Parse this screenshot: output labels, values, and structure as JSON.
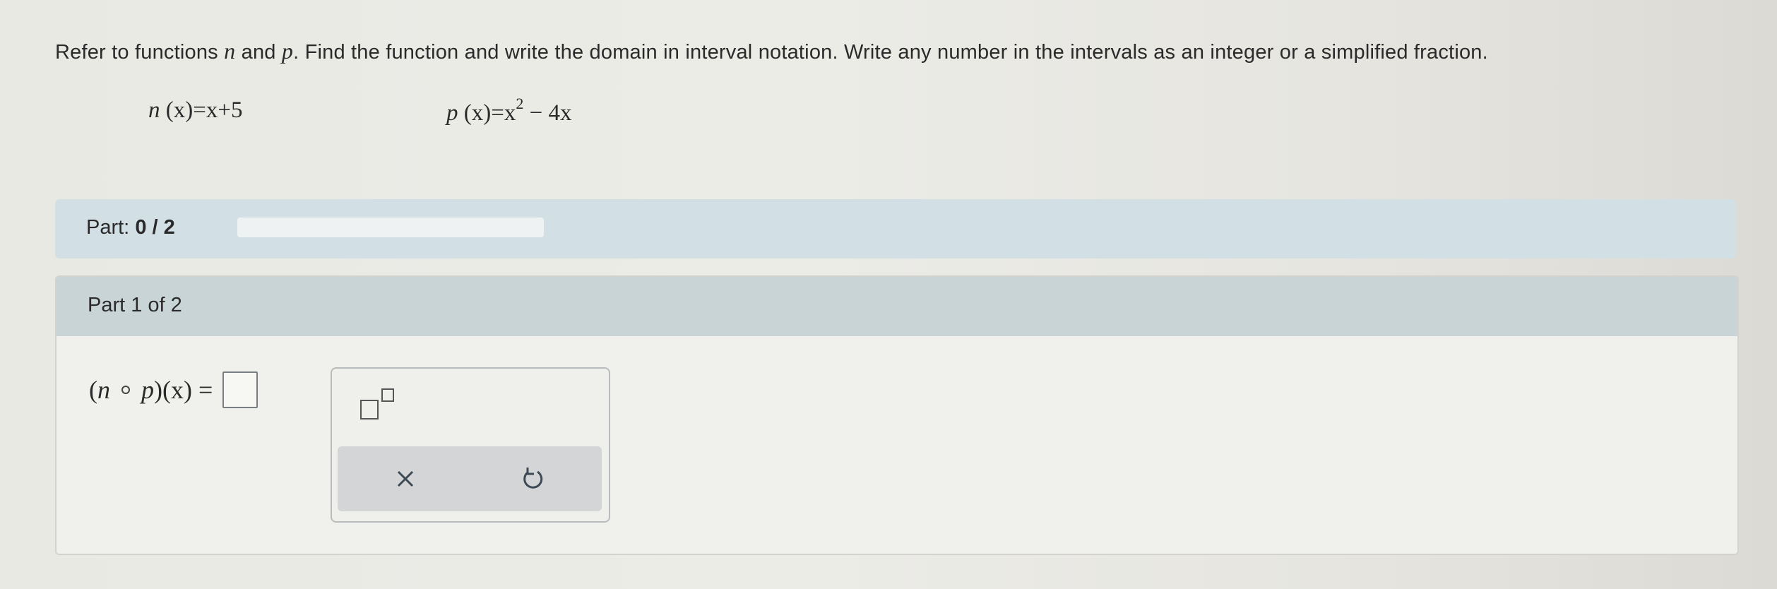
{
  "question": {
    "part1": "Refer to functions ",
    "var_n": "n",
    "part2": " and ",
    "var_p": "p",
    "part3": ". Find the function and write the domain in interval notation. Write any number in the intervals as an integer or a simplified fraction."
  },
  "functions": {
    "n_name": "n",
    "n_arg": "(x)",
    "n_rhs": "=x+5",
    "p_name": "p",
    "p_arg": "(x)",
    "p_rhs_a": "=x",
    "p_exp": "2",
    "p_rhs_b": " − 4x"
  },
  "progress": {
    "label": "Part: ",
    "current": "0",
    "separator": " / ",
    "total": "2",
    "fraction_complete": 0.0
  },
  "part": {
    "title": "Part 1 of 2",
    "expr_open": "(",
    "expr_n": "n",
    "expr_p": "p",
    "expr_close": ")(x) ="
  },
  "palette": {
    "superscript_icon": "superscript-template-icon",
    "clear_icon": "x-icon",
    "undo_icon": "undo-icon"
  },
  "colors": {
    "progress_fill": "#4d8fb3",
    "header_band": "#d2dfe4",
    "part_header": "#c9d4d6"
  }
}
